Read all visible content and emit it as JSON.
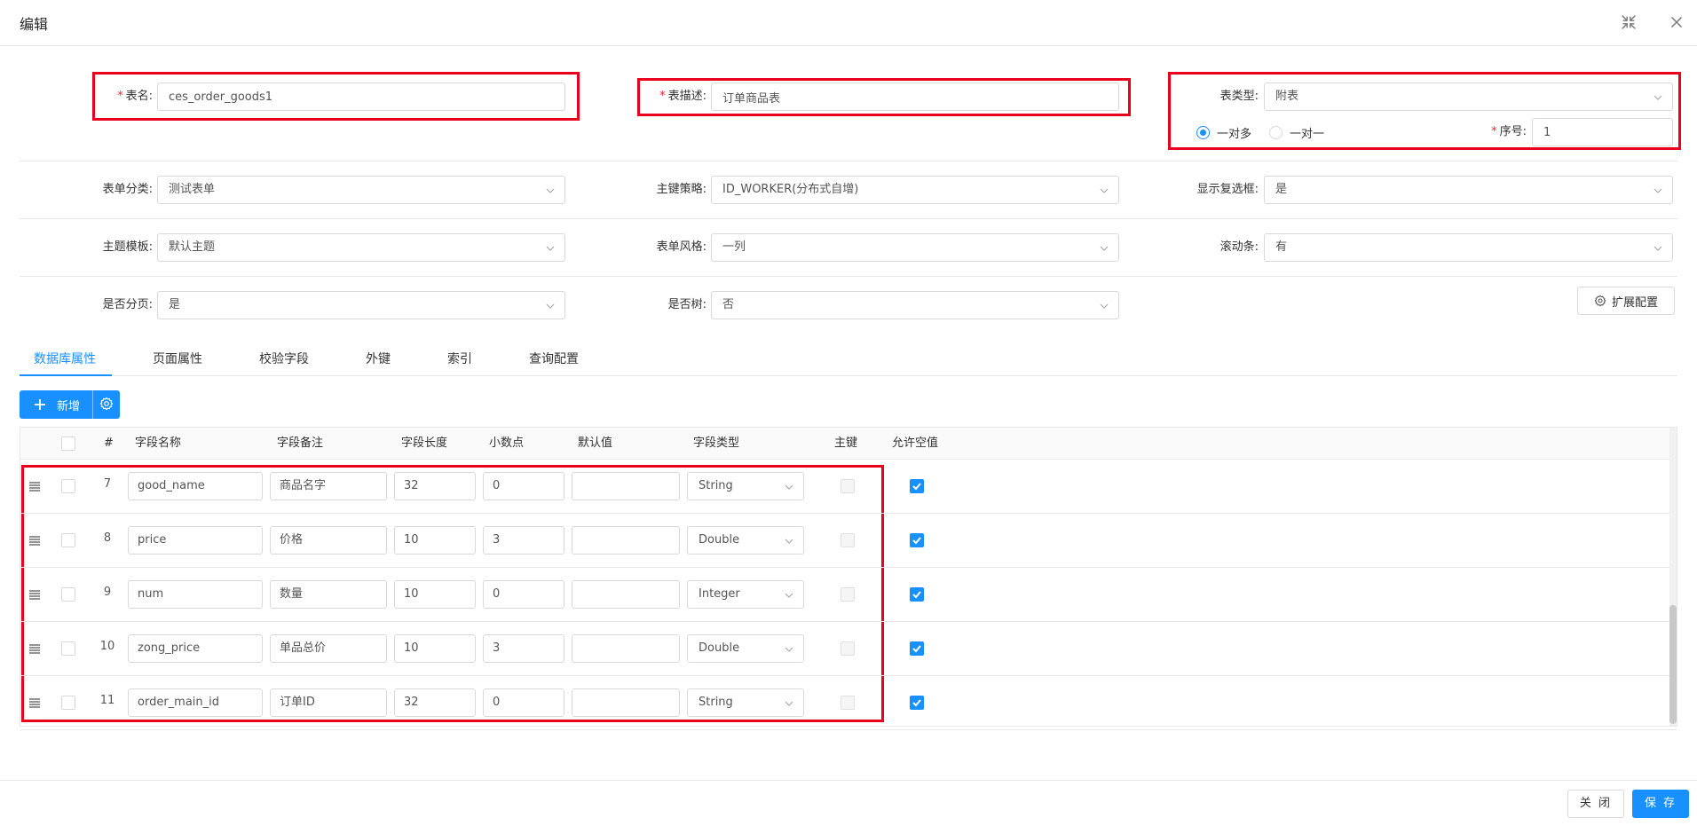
{
  "modal": {
    "title": "编辑",
    "icons": [
      "fullscreen-exit-icon",
      "close-icon"
    ]
  },
  "form": {
    "table_name": {
      "label": "表名:",
      "value": "ces_order_goods1",
      "required": true
    },
    "table_desc": {
      "label": "表描述:",
      "value": "订单商品表",
      "required": true
    },
    "table_type": {
      "label": "表类型:",
      "value": "附表"
    },
    "relation": {
      "options": [
        "一对多",
        "一对一"
      ],
      "selected": "一对多"
    },
    "seq": {
      "label": "序号:",
      "value": "1",
      "required": true
    },
    "form_category": {
      "label": "表单分类:",
      "value": "测试表单"
    },
    "pk_strategy": {
      "label": "主键策略:",
      "value": "ID_WORKER(分布式自增)"
    },
    "show_checkbox": {
      "label": "显示复选框:",
      "value": "是"
    },
    "theme": {
      "label": "主题模板:",
      "value": "默认主题"
    },
    "form_style": {
      "label": "表单风格:",
      "value": "一列"
    },
    "scrollbar": {
      "label": "滚动条:",
      "value": "有"
    },
    "paging": {
      "label": "是否分页:",
      "value": "是"
    },
    "is_tree": {
      "label": "是否树:",
      "value": "否"
    },
    "ext_config_label": "扩展配置"
  },
  "tabs": [
    "数据库属性",
    "页面属性",
    "校验字段",
    "外键",
    "索引",
    "查询配置"
  ],
  "active_tab": "数据库属性",
  "toolbar": {
    "add_label": "新增"
  },
  "table": {
    "headers": [
      "#",
      "字段名称",
      "字段备注",
      "字段长度",
      "小数点",
      "默认值",
      "字段类型",
      "主键",
      "允许空值"
    ],
    "rows": [
      {
        "num": "7",
        "name": "good_name",
        "remark": "商品名字",
        "length": "32",
        "decimal": "0",
        "default": "",
        "type": "String",
        "pk": false,
        "nullable": true
      },
      {
        "num": "8",
        "name": "price",
        "remark": "价格",
        "length": "10",
        "decimal": "3",
        "default": "",
        "type": "Double",
        "pk": false,
        "nullable": true
      },
      {
        "num": "9",
        "name": "num",
        "remark": "数量",
        "length": "10",
        "decimal": "0",
        "default": "",
        "type": "Integer",
        "pk": false,
        "nullable": true
      },
      {
        "num": "10",
        "name": "zong_price",
        "remark": "单品总价",
        "length": "10",
        "decimal": "3",
        "default": "",
        "type": "Double",
        "pk": false,
        "nullable": true
      },
      {
        "num": "11",
        "name": "order_main_id",
        "remark": "订单ID",
        "length": "32",
        "decimal": "0",
        "default": "",
        "type": "String",
        "pk": false,
        "nullable": true
      }
    ]
  },
  "footer": {
    "close_label": "关 闭",
    "save_label": "保 存"
  },
  "colors": {
    "primary": "#1890ff",
    "highlight": "#e8001c",
    "required": "#f5222d"
  }
}
